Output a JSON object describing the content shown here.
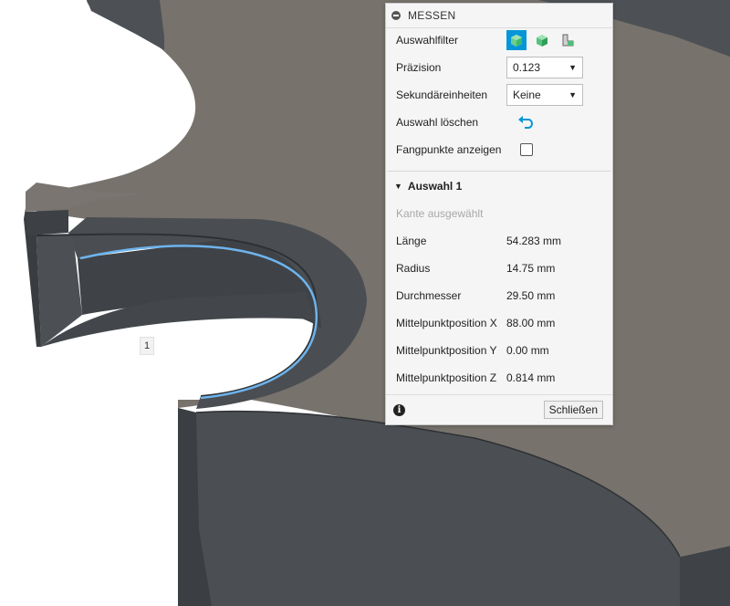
{
  "viewport": {
    "marker_label": "1",
    "colors": {
      "background": "#ffffff",
      "face": "#77726c",
      "wall": "#4b4f53",
      "edge": "#2e3134",
      "highlight": "#6eb4ee"
    }
  },
  "panel": {
    "title": "MESSEN",
    "filter_label": "Auswahlfilter",
    "precision_label": "Präzision",
    "precision_value": "0.123",
    "secondary_units_label": "Sekundäreinheiten",
    "secondary_units_value": "Keine",
    "clear_selection_label": "Auswahl löschen",
    "snap_points_label": "Fangpunkte anzeigen",
    "snap_points_checked": false,
    "section_title": "Auswahl 1",
    "selection_status": "Kante ausgewählt",
    "measurements": [
      {
        "label": "Länge",
        "value": "54.283 mm"
      },
      {
        "label": "Radius",
        "value": "14.75 mm"
      },
      {
        "label": "Durchmesser",
        "value": "29.50 mm"
      },
      {
        "label": "Mittelpunktposition X",
        "value": "88.00 mm"
      },
      {
        "label": "Mittelpunktposition Y",
        "value": "0.00 mm"
      },
      {
        "label": "Mittelpunktposition Z",
        "value": "0.814 mm"
      }
    ],
    "close_label": "Schließen",
    "accent_color": "#0696d7"
  }
}
